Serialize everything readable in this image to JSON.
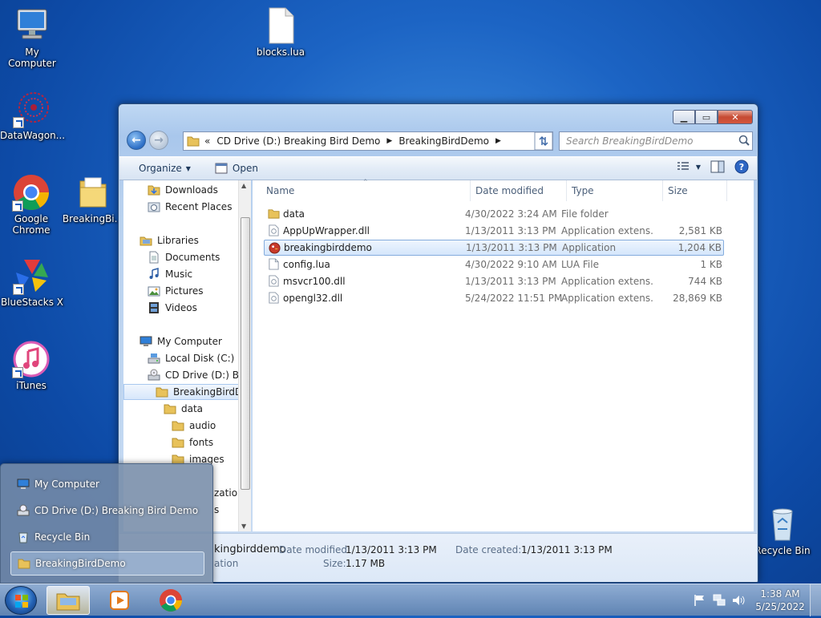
{
  "desktop": {
    "icons": [
      {
        "label": "My Computer"
      },
      {
        "label": "blocks.lua"
      },
      {
        "label": "DataWagon..."
      },
      {
        "label": "Google Chrome"
      },
      {
        "label": "BreakingBi..."
      },
      {
        "label": "BlueStacks X"
      },
      {
        "label": "iTunes"
      },
      {
        "label": "Recycle Bin"
      }
    ]
  },
  "window": {
    "address": {
      "overflow": "«",
      "crumbs": [
        "CD Drive (D:) Breaking Bird Demo",
        "BreakingBirdDemo"
      ]
    },
    "search_placeholder": "Search BreakingBirdDemo",
    "toolbar": {
      "organize": "Organize",
      "open": "Open"
    },
    "nav_items": [
      {
        "label": "Downloads"
      },
      {
        "label": "Recent Places"
      },
      {
        "label": "Libraries"
      },
      {
        "label": "Documents"
      },
      {
        "label": "Music"
      },
      {
        "label": "Pictures"
      },
      {
        "label": "Videos"
      },
      {
        "label": "My Computer"
      },
      {
        "label": "Local Disk (C:)"
      },
      {
        "label": "CD Drive (D:) Bre"
      },
      {
        "label": "BreakingBirdDe"
      },
      {
        "label": "data"
      },
      {
        "label": "audio"
      },
      {
        "label": "fonts"
      },
      {
        "label": "images"
      },
      {
        "label": "zation"
      },
      {
        "label": "s"
      }
    ],
    "columns": [
      "Name",
      "Date modified",
      "Type",
      "Size"
    ],
    "files": [
      {
        "name": "data",
        "date": "4/30/2022 3:24 AM",
        "type": "File folder",
        "size": ""
      },
      {
        "name": "AppUpWrapper.dll",
        "date": "1/13/2011 3:13 PM",
        "type": "Application extens...",
        "size": "2,581 KB"
      },
      {
        "name": "breakingbirddemo",
        "date": "1/13/2011 3:13 PM",
        "type": "Application",
        "size": "1,204 KB"
      },
      {
        "name": "config.lua",
        "date": "4/30/2022 9:10 AM",
        "type": "LUA File",
        "size": "1 KB"
      },
      {
        "name": "msvcr100.dll",
        "date": "1/13/2011 3:13 PM",
        "type": "Application extens...",
        "size": "744 KB"
      },
      {
        "name": "opengl32.dll",
        "date": "5/24/2022 11:51 PM",
        "type": "Application extens...",
        "size": "28,869 KB"
      }
    ],
    "details": {
      "name": "kingbirddemo",
      "kind": "ation",
      "date_modified_label": "Date modified:",
      "date_modified": "1/13/2011 3:13 PM",
      "date_created_label": "Date created:",
      "date_created": "1/13/2011 3:13 PM",
      "size_label": "Size:",
      "size": "1.17 MB"
    }
  },
  "jumplist": {
    "items": [
      {
        "label": "My Computer"
      },
      {
        "label": "CD Drive (D:) Breaking Bird Demo"
      },
      {
        "label": "Recycle Bin"
      },
      {
        "label": "BreakingBirdDemo"
      }
    ]
  },
  "taskbar": {
    "time": "1:38 AM",
    "date": "5/25/2022"
  }
}
